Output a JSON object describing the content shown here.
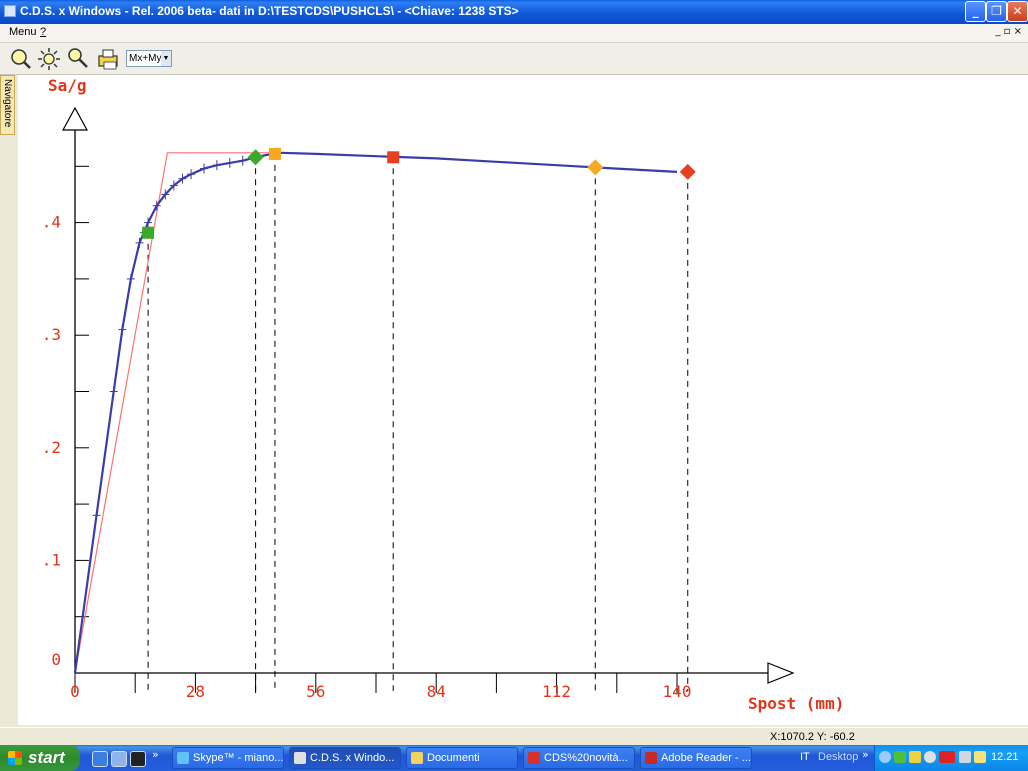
{
  "window": {
    "title": "C.D.S. x Windows - Rel. 2006 beta- dati in D:\\TESTCDS\\PUSHCLS\\ - <Chiave: 1238 STS>",
    "menu": [
      "Menu",
      "?"
    ]
  },
  "toolbar": {
    "view_select": "Mx+My",
    "icons": [
      "zoom-icon",
      "pan-icon",
      "zoom-out-icon",
      "print-icon"
    ]
  },
  "navigator_tab": "Navigatore",
  "chart_data": {
    "type": "line",
    "xlabel": "Spost (mm)",
    "ylabel": "Sa/g",
    "x_ticks": [
      0,
      14,
      28,
      42,
      56,
      70,
      84,
      98,
      112,
      126,
      140
    ],
    "x_tick_labels": [
      "0",
      "28",
      "56",
      "84",
      "112",
      "140"
    ],
    "x_tick_label_values": [
      0,
      28,
      56,
      84,
      112,
      140
    ],
    "y_ticks": [
      0,
      0.05,
      0.1,
      0.15,
      0.2,
      0.25,
      0.3,
      0.35,
      0.4,
      0.45
    ],
    "y_tick_labels": [
      ".1",
      ".2",
      ".3",
      ".4"
    ],
    "y_tick_label_values": [
      0.1,
      0.2,
      0.3,
      0.4
    ],
    "xlim": [
      0,
      160
    ],
    "ylim": [
      0,
      0.5
    ],
    "colors": {
      "curve": "#3c3ca8",
      "bilinear": "#ff7070",
      "green": "#3aaa28",
      "orange": "#f7a81e",
      "red": "#e8401e"
    },
    "series": [
      {
        "role": "capacity-curve",
        "x": [
          0,
          5,
          9,
          11,
          13,
          15,
          16,
          17,
          19,
          21,
          23,
          25,
          27,
          30,
          33,
          36,
          39,
          42,
          44.5,
          48,
          56,
          70,
          84,
          98,
          112,
          126,
          140
        ],
        "y": [
          0,
          0.14,
          0.25,
          0.305,
          0.35,
          0.382,
          0.391,
          0.4,
          0.415,
          0.425,
          0.433,
          0.439,
          0.443,
          0.448,
          0.451,
          0.453,
          0.455,
          0.458,
          0.46,
          0.462,
          0.461,
          0.459,
          0.457,
          0.454,
          0.451,
          0.448,
          0.445
        ]
      },
      {
        "role": "bilinear",
        "x": [
          0,
          21.5,
          48
        ],
        "y": [
          0,
          0.462,
          0.462
        ]
      }
    ],
    "markers": [
      {
        "x": 17,
        "y": 0.391,
        "shape": "square",
        "color": "green"
      },
      {
        "x": 42,
        "y": 0.458,
        "shape": "diamond",
        "color": "green"
      },
      {
        "x": 46.5,
        "y": 0.461,
        "shape": "square",
        "color": "orange"
      },
      {
        "x": 74,
        "y": 0.458,
        "shape": "square",
        "color": "red"
      },
      {
        "x": 121,
        "y": 0.449,
        "shape": "diamond",
        "color": "orange"
      },
      {
        "x": 142.5,
        "y": 0.445,
        "shape": "diamond",
        "color": "red"
      }
    ]
  },
  "status": {
    "coords": "X:1070.2  Y: -60.2"
  },
  "taskbar": {
    "start": "start",
    "tasks": [
      {
        "label": "Skype™ - miano...",
        "active": false
      },
      {
        "label": "C.D.S. x Windo...",
        "active": true
      },
      {
        "label": "Documenti",
        "active": false
      },
      {
        "label": "CDS%20novità...",
        "active": false
      },
      {
        "label": "Adobe Reader - ...",
        "active": false
      }
    ],
    "lang": "IT",
    "desktop": "Desktop",
    "clock": "12.21"
  }
}
